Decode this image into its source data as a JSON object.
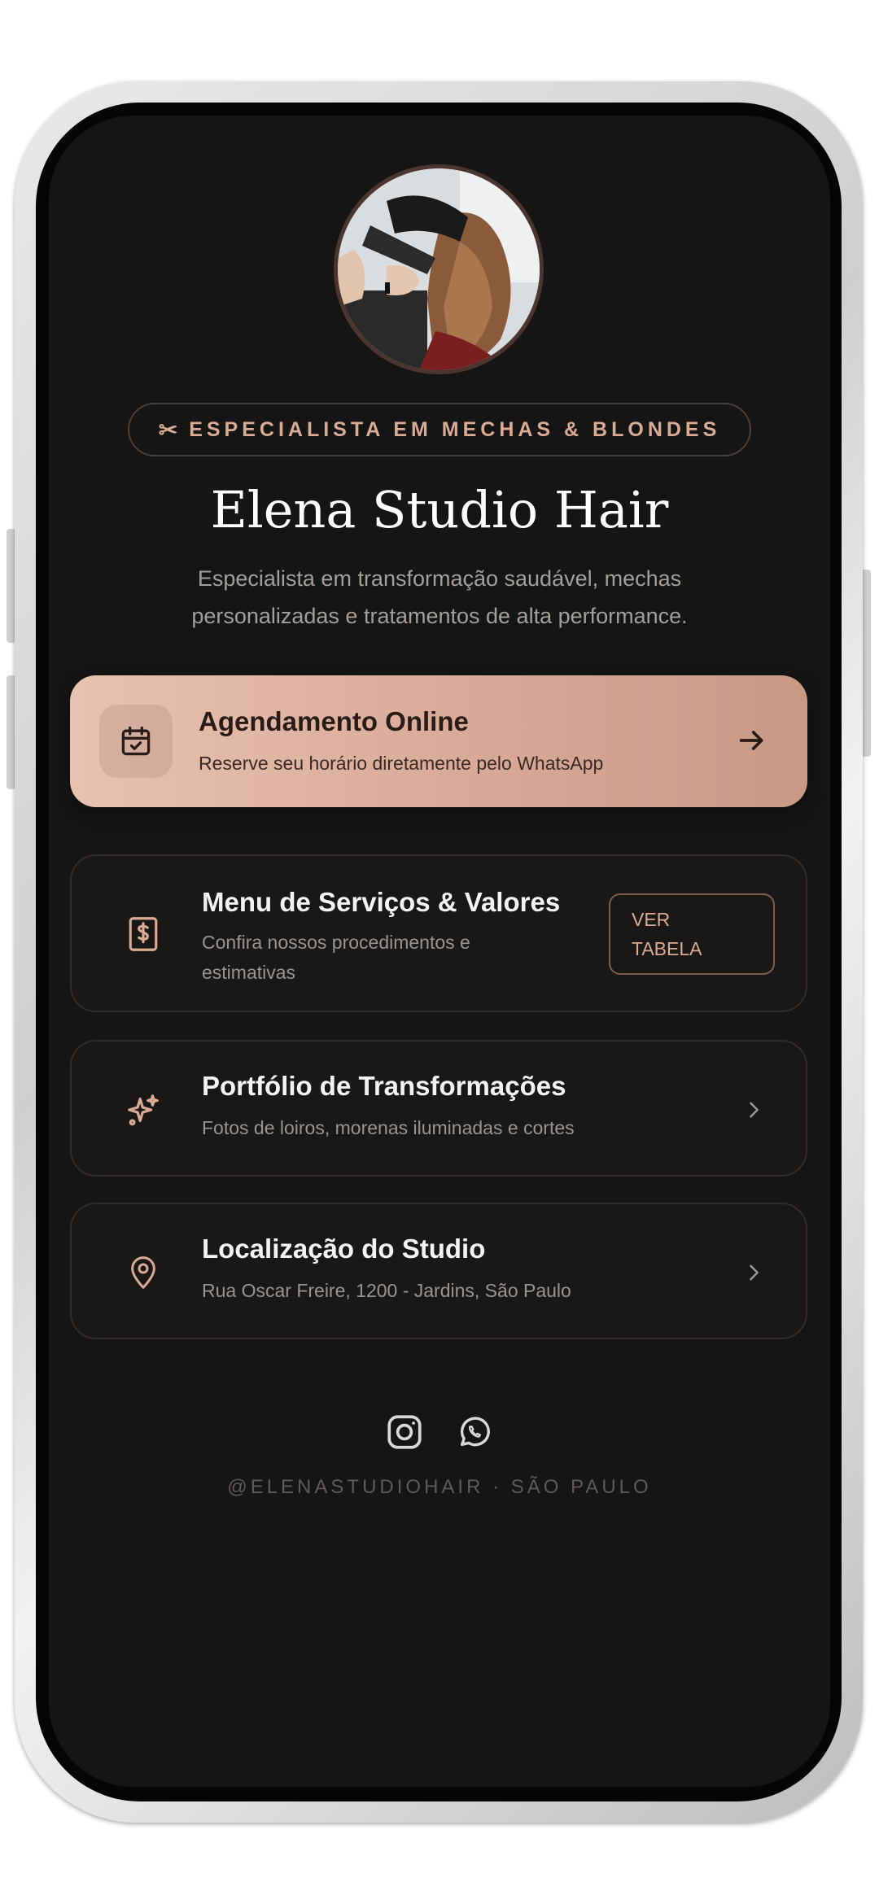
{
  "profile": {
    "badge_icon": "scissors-icon",
    "badge_text": "ESPECIALISTA EM MECHAS & BLONDES",
    "name": "Elena Studio Hair",
    "bio_line1": "Especialista em transformação saudável, mechas",
    "bio_line2": "personalizadas e tratamentos de alta performance."
  },
  "primary_card": {
    "icon": "calendar-check-icon",
    "title": "Agendamento Online",
    "description": "Reserve seu horário diretamente pelo WhatsApp",
    "action_icon": "arrow-right-icon"
  },
  "cards": [
    {
      "icon": "dollar-receipt-icon",
      "title": "Menu de Serviços & Valores",
      "description_line1": "Confira nossos procedimentos e",
      "description_line2": "estimativas",
      "button_line1": "VER",
      "button_line2": "TABELA"
    },
    {
      "icon": "sparkles-icon",
      "title": "Portfólio de Transformações",
      "description": "Fotos de loiros, morenas iluminadas e cortes",
      "action_icon": "chevron-right-icon"
    },
    {
      "icon": "map-pin-icon",
      "title": "Localização do Studio",
      "description": "Rua Oscar Freire, 1200 - Jardins, São Paulo",
      "action_icon": "chevron-right-icon"
    }
  ],
  "footer": {
    "icons": [
      "instagram-icon",
      "whatsapp-icon"
    ],
    "handle": "@ELENASTUDIOHAIR · SÃO PAULO"
  },
  "colors": {
    "background": "#151515",
    "accent": "#d9ab95",
    "primary_card": "#dcae9c",
    "card_dark": "#191817"
  }
}
